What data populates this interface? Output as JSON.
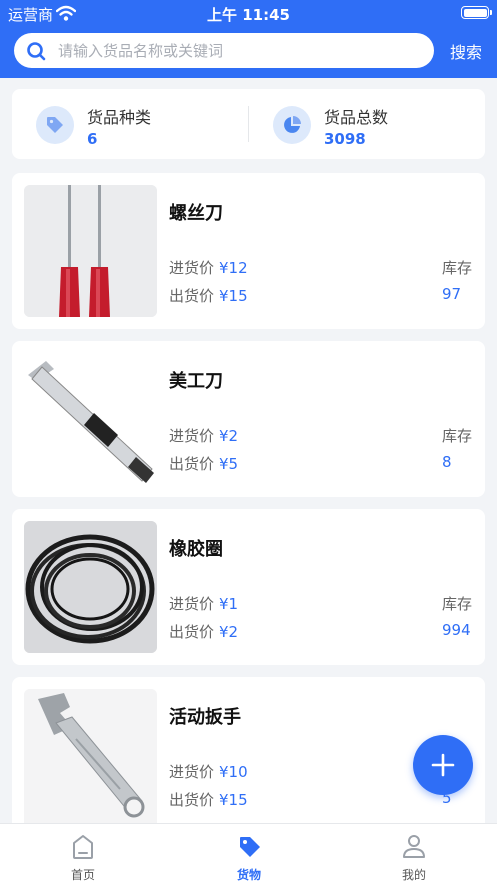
{
  "status_bar": {
    "carrier": "运营商",
    "time": "上午 11:45"
  },
  "search": {
    "placeholder": "请输入货品名称或关键词",
    "button_label": "搜索"
  },
  "stats": {
    "categories_label": "货品种类",
    "categories_value": "6",
    "total_label": "货品总数",
    "total_value": "3098"
  },
  "items": [
    {
      "name": "螺丝刀",
      "in_label": "进货价",
      "in_price": "¥12",
      "out_label": "出货价",
      "out_price": "¥15",
      "stock_label": "库存",
      "stock": "97",
      "image": "screwdriver"
    },
    {
      "name": "美工刀",
      "in_label": "进货价",
      "in_price": "¥2",
      "out_label": "出货价",
      "out_price": "¥5",
      "stock_label": "库存",
      "stock": "8",
      "image": "utility-knife"
    },
    {
      "name": "橡胶圈",
      "in_label": "进货价",
      "in_price": "¥1",
      "out_label": "出货价",
      "out_price": "¥2",
      "stock_label": "库存",
      "stock": "994",
      "image": "rubber-ring"
    },
    {
      "name": "活动扳手",
      "in_label": "进货价",
      "in_price": "¥10",
      "out_label": "出货价",
      "out_price": "¥15",
      "stock_label": "库存",
      "stock": "5",
      "image": "wrench"
    }
  ],
  "tabs": [
    {
      "label": "首页",
      "icon": "home-icon",
      "active": false
    },
    {
      "label": "货物",
      "icon": "tag-icon",
      "active": true
    },
    {
      "label": "我的",
      "icon": "user-icon",
      "active": false
    }
  ],
  "colors": {
    "primary": "#2f6ef6",
    "background": "#f2f4f7",
    "text_secondary": "#666666"
  }
}
